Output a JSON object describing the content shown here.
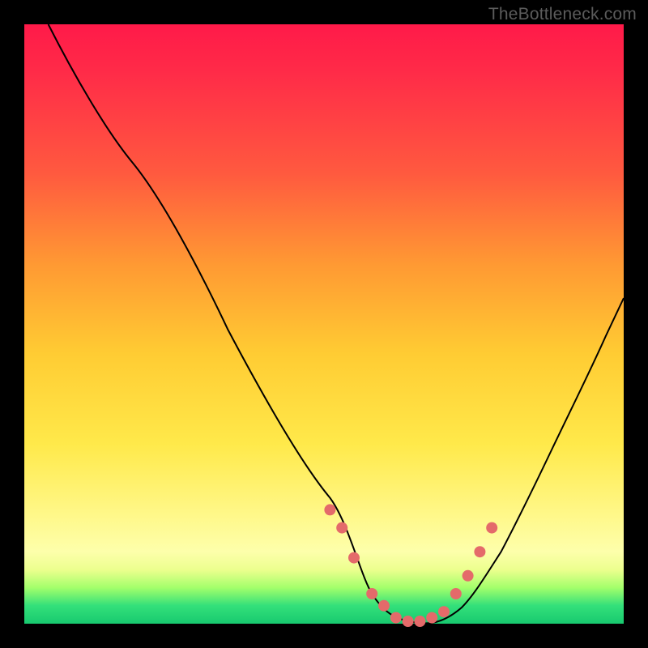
{
  "watermark": "TheBottleneck.com",
  "chart_data": {
    "type": "line",
    "title": "",
    "xlabel": "",
    "ylabel": "",
    "xlim": [
      0,
      100
    ],
    "ylim": [
      0,
      100
    ],
    "grid": false,
    "legend": false,
    "background_gradient": {
      "direction": "vertical",
      "stops": [
        {
          "pos": 0.0,
          "color": "#ff1a49"
        },
        {
          "pos": 0.25,
          "color": "#ff5a3f"
        },
        {
          "pos": 0.55,
          "color": "#ffcc33"
        },
        {
          "pos": 0.82,
          "color": "#fff88a"
        },
        {
          "pos": 0.94,
          "color": "#a3ff6b"
        },
        {
          "pos": 1.0,
          "color": "#18c96f"
        }
      ]
    },
    "series": [
      {
        "name": "fit-curve",
        "kind": "line",
        "color": "#000000",
        "x": [
          4,
          10,
          18,
          26,
          34,
          42,
          50,
          55,
          58,
          62,
          66,
          70,
          74,
          78,
          84,
          90,
          97
        ],
        "y": [
          100,
          90,
          77,
          63,
          49,
          35,
          21,
          11,
          5,
          1,
          0,
          1,
          5,
          12,
          25,
          40,
          57
        ]
      },
      {
        "name": "data-points",
        "kind": "scatter",
        "color": "#e46a6a",
        "x": [
          51,
          53,
          55,
          58,
          60,
          62,
          64,
          66,
          68,
          70,
          72,
          74,
          76,
          78
        ],
        "y": [
          19,
          16,
          11,
          5,
          3,
          1,
          0,
          0,
          1,
          2,
          5,
          8,
          12,
          16
        ]
      }
    ]
  }
}
